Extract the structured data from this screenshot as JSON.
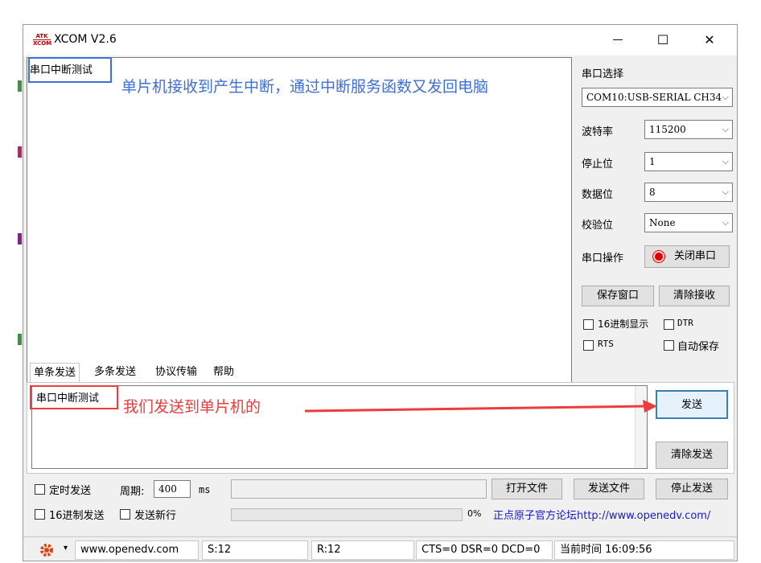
{
  "window": {
    "title": "XCOM V2.6",
    "logo_top": "ATK",
    "logo_bottom": "XCOM",
    "minimize": "—",
    "maximize": "☐",
    "close": "✕"
  },
  "receive": {
    "text": "串口中断测试",
    "annotation": "单片机接收到产生中断，通过中断服务函数又发回电脑"
  },
  "settings": {
    "port_label": "串口选择",
    "port_value": "COM10:USB-SERIAL CH34",
    "baud_label": "波特率",
    "baud_value": "115200",
    "stop_label": "停止位",
    "stop_value": "1",
    "data_label": "数据位",
    "data_value": "8",
    "parity_label": "校验位",
    "parity_value": "None",
    "op_label": "串口操作",
    "op_button": "关闭串口",
    "save_window": "保存窗口",
    "clear_receive": "清除接收",
    "hex_display": "16进制显示",
    "dtr": "DTR",
    "rts": "RTS",
    "auto_save": "自动保存",
    "chevron": "⌵"
  },
  "tabs": [
    "单条发送",
    "多条发送",
    "协议传输",
    "帮助"
  ],
  "send": {
    "text": "串口中断测试",
    "annotation": "我们发送到单片机的",
    "send_button": "发送",
    "clear_send": "清除发送",
    "timed_send": "定时发送",
    "period_label": "周期:",
    "period_value": "400",
    "ms": "ms",
    "open_file": "打开文件",
    "send_file": "发送文件",
    "stop_send": "停止发送",
    "hex_send": "16进制发送",
    "send_newline": "发送新行",
    "progress": "0%",
    "forum_link": "正点原子官方论坛http://www.openedv.com/"
  },
  "status": {
    "url": "www.openedv.com",
    "sent": "S:12",
    "received": "R:12",
    "lines": "CTS=0 DSR=0 DCD=0",
    "time": "当前时间 16:09:56"
  },
  "colors": {
    "annotation_blue": "#3f6fd8",
    "annotation_red": "#ef3b3b",
    "link_blue": "#1a1ac8"
  }
}
